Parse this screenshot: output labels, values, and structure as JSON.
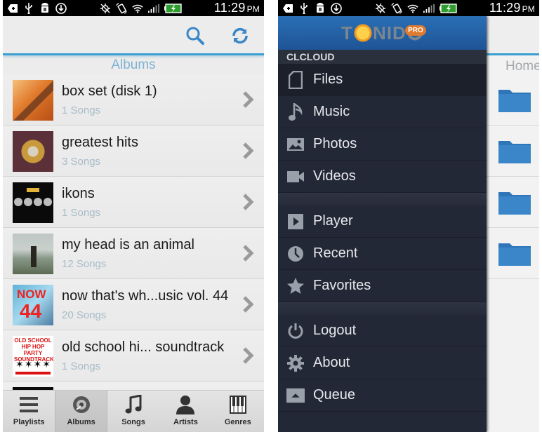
{
  "status_bar": {
    "time": "11:29",
    "ampm": "PM",
    "icons": [
      "notification-icon",
      "usb-icon",
      "android-debug-icon",
      "download-icon",
      "gps-off-icon",
      "rotation-icon",
      "wifi-icon",
      "signal-icon",
      "battery-charging-icon"
    ]
  },
  "left_screen": {
    "actionbar": {
      "search_icon": "search-icon",
      "refresh_icon": "refresh-icon"
    },
    "section_title": "Albums",
    "albums": [
      {
        "title": "box set (disk 1)",
        "subtitle": "1 Songs"
      },
      {
        "title": "greatest hits",
        "subtitle": "3 Songs"
      },
      {
        "title": "ikons",
        "subtitle": "1 Songs"
      },
      {
        "title": "my head is an animal",
        "subtitle": "12 Songs"
      },
      {
        "title": "now that's wh...usic vol. 44",
        "subtitle": "20 Songs",
        "cover_text": "NOW",
        "cover_number": "44"
      },
      {
        "title": "old school hi... soundtrack",
        "subtitle": "1 Songs",
        "cover_text": "OLD SCHOOL HIP HOP PARTY SOUNDTRACK"
      }
    ],
    "bottom_tabs": [
      {
        "label": "Playlists",
        "icon": "playlists-icon",
        "active": false
      },
      {
        "label": "Albums",
        "icon": "album-disc-icon",
        "active": true
      },
      {
        "label": "Songs",
        "icon": "music-note-icon",
        "active": false
      },
      {
        "label": "Artists",
        "icon": "person-icon",
        "active": false
      },
      {
        "label": "Genres",
        "icon": "piano-icon",
        "active": false
      }
    ]
  },
  "right_screen": {
    "brand": {
      "name_left": "T",
      "name_right": "NID",
      "badge": "PRO"
    },
    "background_title": "Home",
    "account_label": "CLCLOUD",
    "drawer_groups": [
      [
        {
          "label": "Files",
          "icon": "file-icon",
          "selected": true
        },
        {
          "label": "Music",
          "icon": "music-note-icon",
          "selected": false
        },
        {
          "label": "Photos",
          "icon": "photo-icon",
          "selected": false
        },
        {
          "label": "Videos",
          "icon": "video-camera-icon",
          "selected": false
        }
      ],
      [
        {
          "label": "Player",
          "icon": "play-icon",
          "selected": false
        },
        {
          "label": "Recent",
          "icon": "clock-icon",
          "selected": false
        },
        {
          "label": "Favorites",
          "icon": "star-icon",
          "selected": false
        }
      ],
      [
        {
          "label": "Logout",
          "icon": "power-icon",
          "selected": false
        },
        {
          "label": "About",
          "icon": "gear-icon",
          "selected": false
        },
        {
          "label": "Queue",
          "icon": "queue-icon",
          "selected": false
        }
      ]
    ],
    "folder_count": 4
  },
  "colors": {
    "accent_blue": "#3a9fd0",
    "drawer_bg": "#232836",
    "folder_blue": "#3a86c8",
    "subtitle": "#a8bcc8"
  }
}
